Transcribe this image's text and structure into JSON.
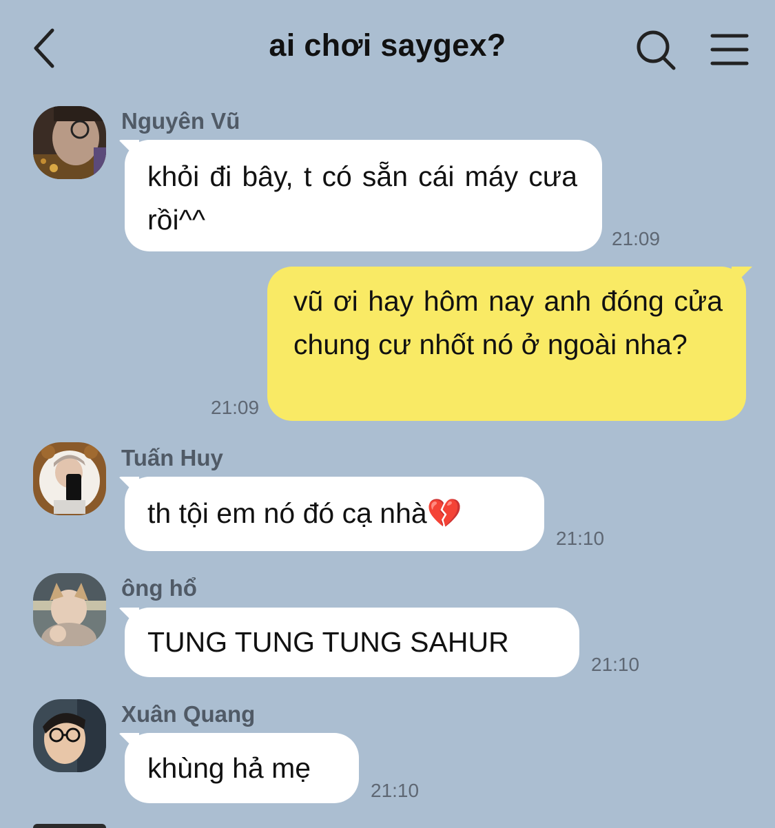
{
  "header": {
    "title": "ai chơi saygex?",
    "back_icon": "chevron-left-icon",
    "search_icon": "search-icon",
    "menu_icon": "menu-icon"
  },
  "messages": [
    {
      "sender": "Nguyên Vũ",
      "text": "khỏi đi bây, t có sẵn cái máy cưa rồi^^",
      "time": "21:09",
      "direction": "incoming"
    },
    {
      "text": "vũ ơi hay hôm nay anh đóng cửa chung cư nhốt nó ở ngoài nha?",
      "time": "21:09",
      "direction": "outgoing"
    },
    {
      "sender": "Tuấn Huy",
      "text": "th tội em nó đó cạ nhà💔",
      "time": "21:10",
      "direction": "incoming"
    },
    {
      "sender": "ông hổ",
      "text": "TUNG TUNG TUNG SAHUR",
      "time": "21:10",
      "direction": "incoming"
    },
    {
      "sender": "Xuân Quang",
      "text": "khùng hả mẹ",
      "time": "21:10",
      "direction": "incoming"
    }
  ],
  "colors": {
    "background": "#abbed1",
    "incoming_bubble": "#ffffff",
    "outgoing_bubble": "#f9ea65"
  }
}
